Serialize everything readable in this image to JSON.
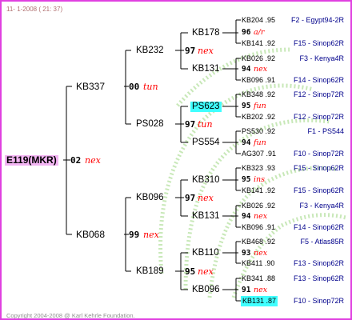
{
  "header": "11-  1-2008 ( 21: 37)",
  "footer": "Copyright 2004-2008 @ Karl Kehrle Foundation.",
  "root": {
    "name": "E119(MKR)",
    "year": "02",
    "note": "nex"
  },
  "gen1": [
    {
      "name": "KB337",
      "year": "00",
      "note": "tun"
    },
    {
      "name": "KB068",
      "year": "99",
      "note": "nex"
    }
  ],
  "gen2": [
    {
      "name": "KB232",
      "year": "97",
      "note": "nex"
    },
    {
      "name": "PS028",
      "year": "97",
      "note": "tun"
    },
    {
      "name": "KB096",
      "year": "97",
      "note": "nex"
    },
    {
      "name": "KB189",
      "year": "95",
      "note": "nex"
    }
  ],
  "gen3": [
    {
      "name": "KB178",
      "year": "96",
      "note": "a/r"
    },
    {
      "name": "KB131",
      "year": "94",
      "note": "nex"
    },
    {
      "name": "PS623",
      "year": "95",
      "note": "fun",
      "highlight": true
    },
    {
      "name": "PS554",
      "year": "94",
      "note": "fun"
    },
    {
      "name": "KB310",
      "year": "95",
      "note": "ins"
    },
    {
      "name": "KB131",
      "year": "94",
      "note": "nex"
    },
    {
      "name": "KB110",
      "year": "93",
      "note": "nex"
    },
    {
      "name": "KB096",
      "year": "91",
      "note": "nex"
    }
  ],
  "gen4": [
    {
      "name": "KB204 .95",
      "race": "F2 - Egypt94-2R"
    },
    {
      "name": "KB141 .92",
      "race": "F15 - Sinop62R"
    },
    {
      "name": "KB026 .92",
      "race": "F3 - Kenya4R"
    },
    {
      "name": "KB096 .91",
      "race": "F14 - Sinop62R"
    },
    {
      "name": "KB348 .92",
      "race": "F12 - Sinop72R"
    },
    {
      "name": "KB202 .92",
      "race": "F12 - Sinop72R"
    },
    {
      "name": "PS530 .92",
      "race": "F1 - PS544"
    },
    {
      "name": "AG307 .91",
      "race": "F10 - Sinop72R"
    },
    {
      "name": "KB323 .93",
      "race": "F15 - Sinop62R"
    },
    {
      "name": "KB141 .92",
      "race": "F15 - Sinop62R"
    },
    {
      "name": "KB026 .92",
      "race": "F3 - Kenya4R"
    },
    {
      "name": "KB096 .91",
      "race": "F14 - Sinop62R"
    },
    {
      "name": "KB468 .92",
      "race": "F5 - Atlas85R"
    },
    {
      "name": "KB411 .90",
      "race": "F13 - Sinop62R"
    },
    {
      "name": "KB341 .88",
      "race": "F13 - Sinop62R"
    },
    {
      "name": "KB131 .87",
      "race": "F10 - Sinop72R",
      "highlight": true
    }
  ],
  "colors": {
    "border": "#e040e0",
    "note": "#ff0000",
    "race": "#00008b",
    "root_bg": "#f3b5f3",
    "highlight": "#40ffff"
  }
}
